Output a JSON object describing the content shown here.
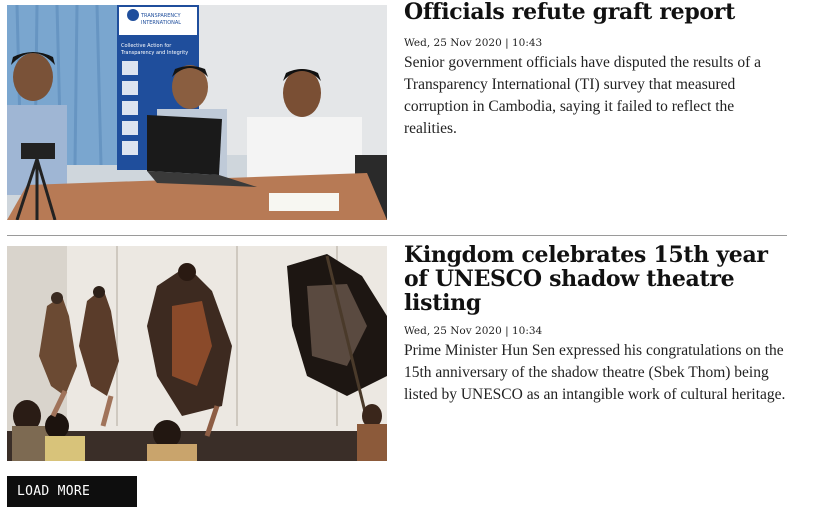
{
  "articles": [
    {
      "headline": "Officials refute graft report",
      "date": "Wed, 25 Nov 2020 | 10:43",
      "summary": "Senior government officials have disputed the results of a Transparency International (TI) survey that measured corruption in Cambodia, saying it failed to reflect the realities.",
      "image_banner_lines": [
        "TRANSPARENCY",
        "INTERNATIONAL",
        "Collective Action for",
        "Transparency and Integrity"
      ]
    },
    {
      "headline": "Kingdom celebrates 15th year of UNESCO shadow theatre listing",
      "date": "Wed, 25 Nov 2020 | 10:34",
      "summary": "Prime Minister Hun Sen expressed his congratulations on the 15th anniversary of the shadow theatre (Sbek Thom) being listed by UNESCO as an intangible work of cultural heritage."
    }
  ],
  "load_more_label": "LOAD MORE"
}
